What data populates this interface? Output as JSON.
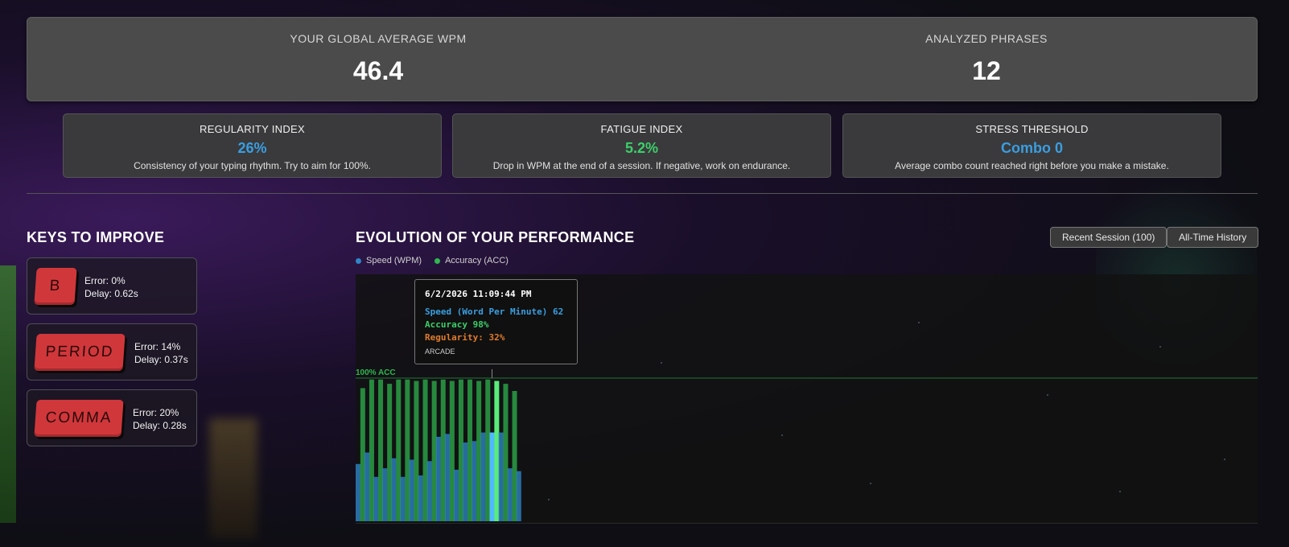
{
  "top_stats": {
    "avg_wpm_label": "YOUR GLOBAL AVERAGE WPM",
    "avg_wpm_value": "46.4",
    "phrases_label": "ANALYZED PHRASES",
    "phrases_value": "12"
  },
  "indices": [
    {
      "label": "REGULARITY INDEX",
      "value": "26%",
      "desc": "Consistency of your typing rhythm. Try to aim for 100%."
    },
    {
      "label": "FATIGUE INDEX",
      "value": "5.2%",
      "desc": "Drop in WPM at the end of a session. If negative, work on endurance."
    },
    {
      "label": "STRESS THRESHOLD",
      "value": "Combo 0",
      "desc": "Average combo count reached right before you make a mistake."
    }
  ],
  "keys_section": {
    "title": "KEYS TO IMPROVE",
    "keys": [
      {
        "key": "B",
        "error": "Error: 0%",
        "delay": "Delay: 0.62s"
      },
      {
        "key": "PERIOD",
        "error": "Error: 14%",
        "delay": "Delay: 0.37s"
      },
      {
        "key": "COMMA",
        "error": "Error: 20%",
        "delay": "Delay: 0.28s"
      }
    ]
  },
  "performance": {
    "title": "EVOLUTION OF YOUR PERFORMANCE",
    "buttons": {
      "recent": "Recent Session (100)",
      "all_time": "All-Time History"
    },
    "legend": {
      "speed": "Speed (WPM)",
      "accuracy": "Accuracy (ACC)"
    },
    "acc_line_label": "100% ACC",
    "tooltip": {
      "date": "6/2/2026 11:09:44 PM",
      "speed": "Speed (Word Per Minute) 62",
      "accuracy": "Accuracy 98%",
      "regularity": "Regularity: 32%",
      "mode": "ARCADE"
    }
  },
  "colors": {
    "speed": "#2f86c8",
    "accuracy": "#2fb84f",
    "highlight_speed": "#4fb8ff",
    "highlight_acc": "#5aeb7a",
    "acc_line": "#2fb84f"
  },
  "chart_data": {
    "type": "bar",
    "ylim": [
      0,
      100
    ],
    "highlight_index": 15,
    "series": [
      {
        "name": "Speed (WPM)",
        "values": [
          40,
          48,
          31,
          37,
          44,
          31,
          43,
          32,
          42,
          59,
          61,
          36,
          55,
          56,
          62,
          62,
          62,
          37,
          35
        ]
      },
      {
        "name": "Accuracy (ACC)",
        "values": [
          93,
          99,
          99,
          96,
          99,
          99,
          98,
          99,
          98,
          99,
          98,
          99,
          99,
          98,
          99,
          98,
          96,
          91,
          0
        ]
      }
    ]
  }
}
